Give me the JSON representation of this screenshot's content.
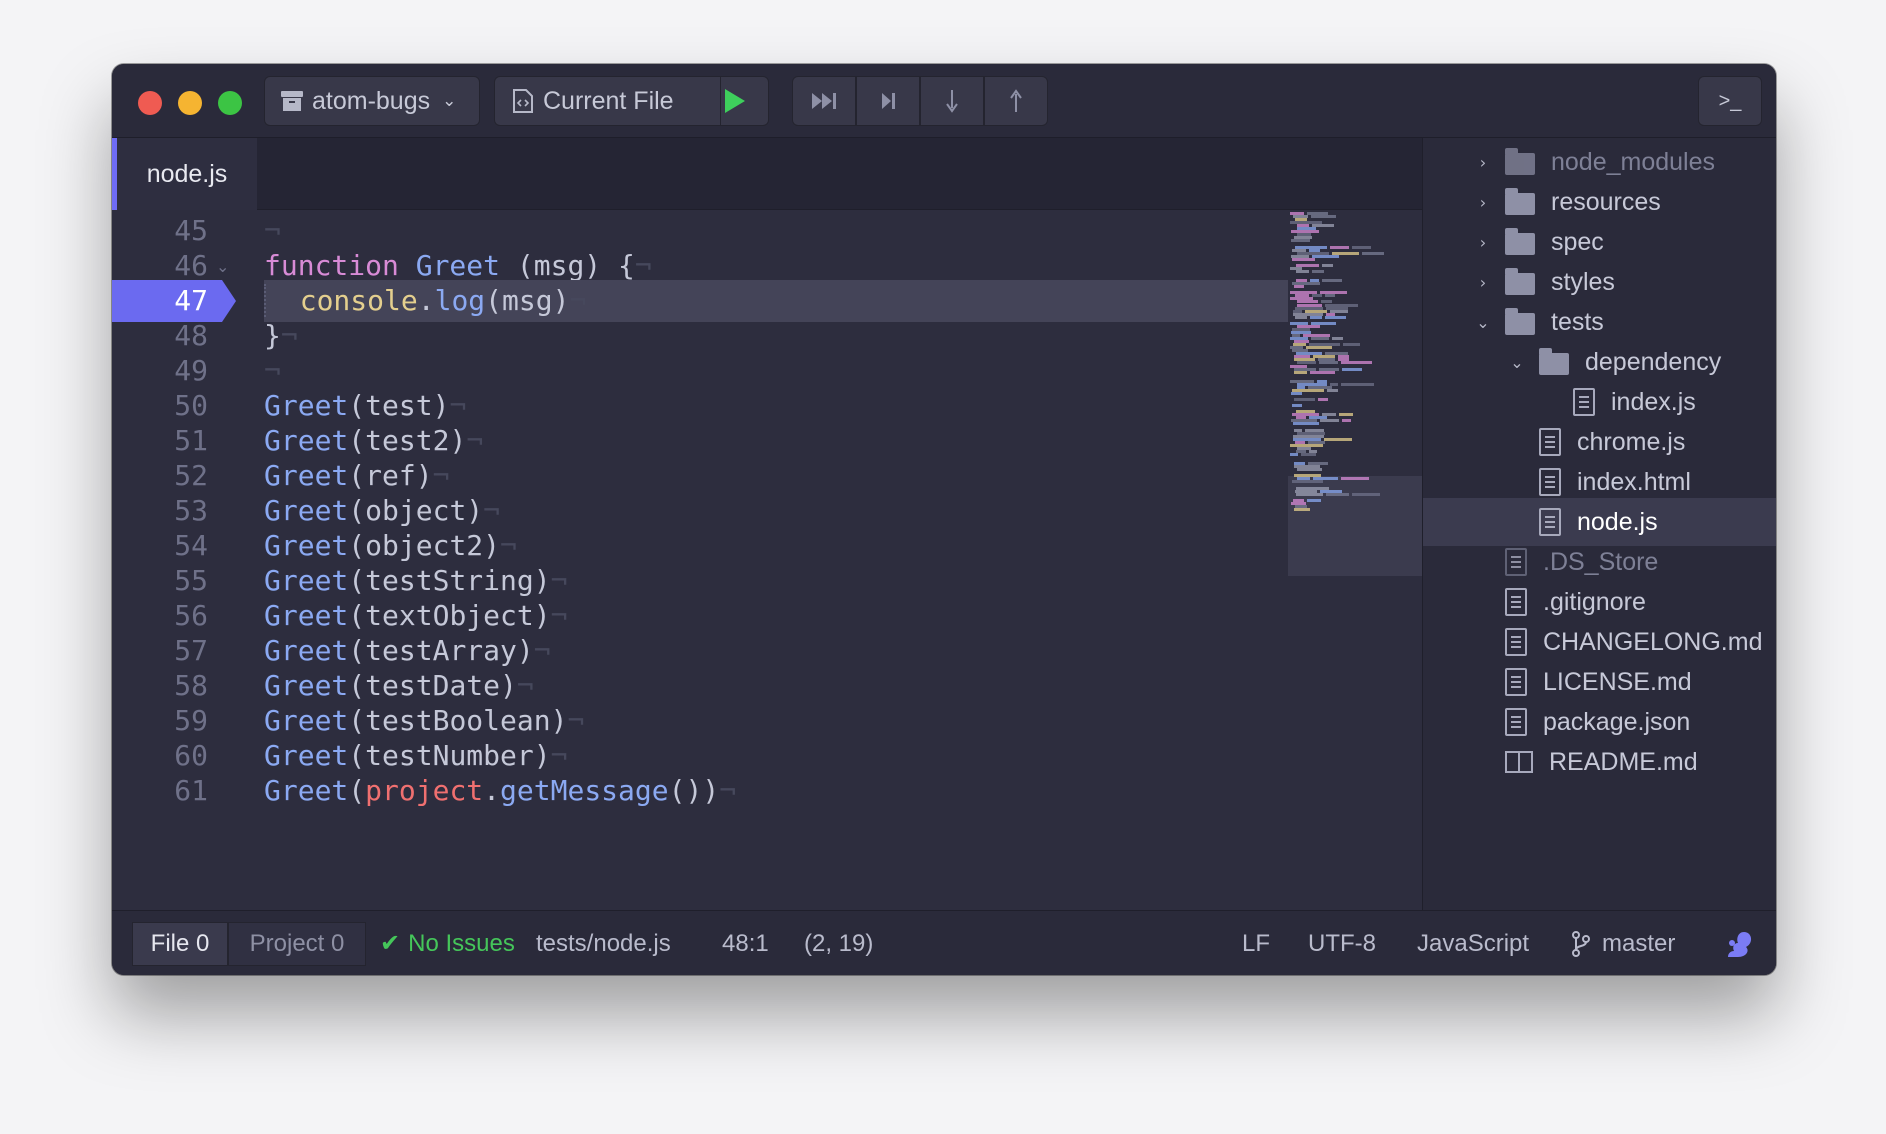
{
  "window": {
    "project_name": "atom-bugs",
    "file_button_label": "Current File",
    "icons": [
      "archive-icon",
      "chevron-down-icon",
      "file-code-icon",
      "play-icon",
      "step-over-fast-icon",
      "step-next-icon",
      "step-into-icon",
      "step-out-icon",
      "terminal-icon"
    ],
    "terminal_label": ">_"
  },
  "tabs": [
    {
      "label": "node.js",
      "active": true
    }
  ],
  "editor": {
    "active_line": "47",
    "lines": [
      {
        "n": "45"
      },
      {
        "n": "46"
      },
      {
        "n": "47"
      },
      {
        "n": "48"
      },
      {
        "n": "49"
      },
      {
        "n": "50"
      },
      {
        "n": "51"
      },
      {
        "n": "52"
      },
      {
        "n": "53"
      },
      {
        "n": "54"
      },
      {
        "n": "55"
      },
      {
        "n": "56"
      },
      {
        "n": "57"
      },
      {
        "n": "58"
      },
      {
        "n": "59"
      },
      {
        "n": "60"
      },
      {
        "n": "61"
      }
    ],
    "code": {
      "l46_kw": "function",
      "l46_fn": "Greet",
      "l46_rest": " (msg) {",
      "l47_obj": "console",
      "l47_dot": ".",
      "l47_fn": "log",
      "l47_rest": "(msg)",
      "l48": "}",
      "calls": [
        {
          "fn": "Greet",
          "args": "(test)"
        },
        {
          "fn": "Greet",
          "args": "(test2)"
        },
        {
          "fn": "Greet",
          "args": "(ref)"
        },
        {
          "fn": "Greet",
          "args": "(object)"
        },
        {
          "fn": "Greet",
          "args": "(object2)"
        },
        {
          "fn": "Greet",
          "args": "(testString)"
        },
        {
          "fn": "Greet",
          "args": "(textObject)"
        },
        {
          "fn": "Greet",
          "args": "(testArray)"
        },
        {
          "fn": "Greet",
          "args": "(testDate)"
        },
        {
          "fn": "Greet",
          "args": "(testBoolean)"
        },
        {
          "fn": "Greet",
          "args": "(testNumber)"
        }
      ],
      "l61_fn": "Greet",
      "l61_open": "(",
      "l61_obj": "project",
      "l61_dot": ".",
      "l61_method": "getMessage",
      "l61_close": "())",
      "invisible_eol": "¬"
    }
  },
  "tree": {
    "items": [
      {
        "label": "node_modules",
        "type": "folder",
        "expanded": false,
        "dim": true
      },
      {
        "label": "resources",
        "type": "folder",
        "expanded": false
      },
      {
        "label": "spec",
        "type": "folder",
        "expanded": false
      },
      {
        "label": "styles",
        "type": "folder",
        "expanded": false
      },
      {
        "label": "tests",
        "type": "folder",
        "expanded": true
      },
      {
        "label": "dependency",
        "type": "folder",
        "expanded": true
      },
      {
        "label": "index.js",
        "type": "file"
      },
      {
        "label": "chrome.js",
        "type": "file"
      },
      {
        "label": "index.html",
        "type": "file"
      },
      {
        "label": "node.js",
        "type": "file",
        "selected": true
      },
      {
        "label": ".DS_Store",
        "type": "file",
        "dim": true
      },
      {
        "label": ".gitignore",
        "type": "file"
      },
      {
        "label": "CHANGELONG.md",
        "type": "file"
      },
      {
        "label": "LICENSE.md",
        "type": "file"
      },
      {
        "label": "package.json",
        "type": "file"
      },
      {
        "label": "README.md",
        "type": "book"
      }
    ]
  },
  "status": {
    "file_count": "File 0",
    "project_count": "Project 0",
    "issues": "No Issues",
    "path": "tests/node.js",
    "cursor": "48:1",
    "selection": "(2, 19)",
    "line_ending": "LF",
    "encoding": "UTF-8",
    "grammar": "JavaScript",
    "branch": "master"
  },
  "colors": {
    "accent": "#6b6af0",
    "keyword": "#d88bd6",
    "function": "#8ba9f2",
    "class": "#e4cf8e",
    "property": "#f07070",
    "success": "#45c65a"
  }
}
